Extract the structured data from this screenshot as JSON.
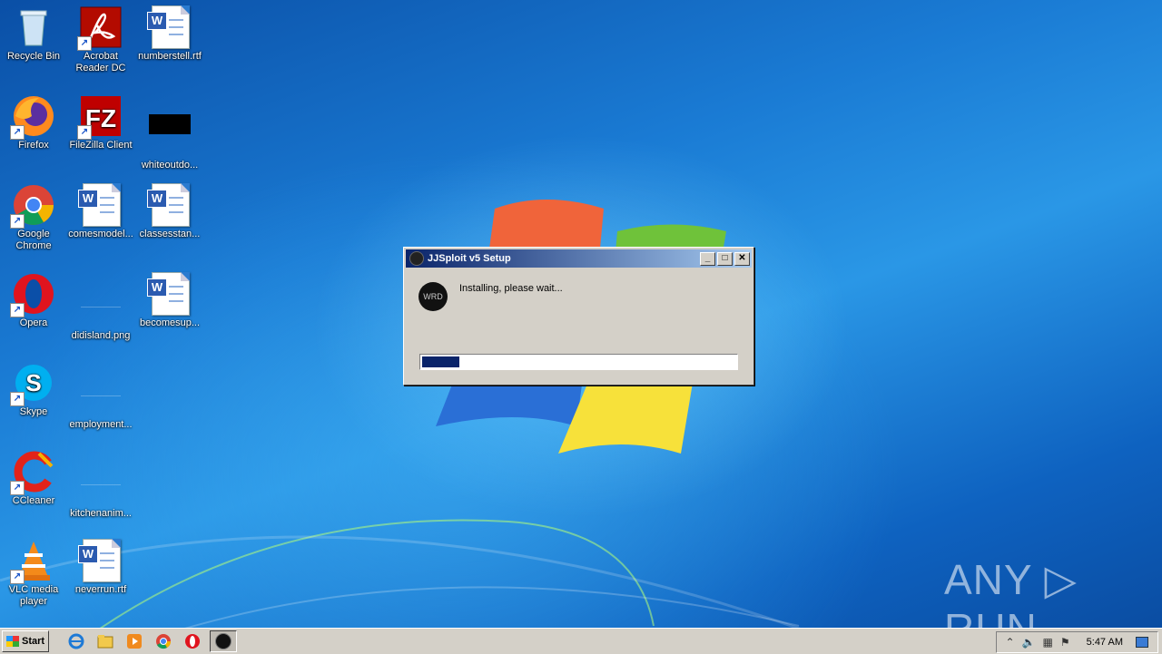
{
  "desktop": {
    "icons": [
      {
        "label": "Recycle Bin",
        "icon": "recycle-bin-icon"
      },
      {
        "label": "Acrobat Reader DC",
        "icon": "acrobat-icon"
      },
      {
        "label": "numberstell.rtf",
        "icon": "word-doc-icon"
      },
      {
        "label": "Firefox",
        "icon": "firefox-icon"
      },
      {
        "label": "FileZilla Client",
        "icon": "filezilla-icon"
      },
      {
        "label": "whiteoutdo...",
        "icon": "black-image-icon"
      },
      {
        "label": "Google Chrome",
        "icon": "chrome-icon"
      },
      {
        "label": "comesmodel...",
        "icon": "word-doc-icon"
      },
      {
        "label": "classesstan...",
        "icon": "word-doc-icon"
      },
      {
        "label": "Opera",
        "icon": "opera-icon"
      },
      {
        "label": "didisland.png",
        "icon": "image-file-icon"
      },
      {
        "label": "becomesup...",
        "icon": "word-doc-icon"
      },
      {
        "label": "Skype",
        "icon": "skype-icon"
      },
      {
        "label": "employment...",
        "icon": "file-icon"
      },
      {
        "label": "CCleaner",
        "icon": "ccleaner-icon"
      },
      {
        "label": "kitchenanim...",
        "icon": "file-icon"
      },
      {
        "label": "VLC media player",
        "icon": "vlc-icon"
      },
      {
        "label": "neverrun.rtf",
        "icon": "word-doc-icon"
      }
    ]
  },
  "dialog": {
    "title": "JJSploit v5 Setup",
    "logo_text": "WRD",
    "message": "Installing, please wait...",
    "progress": 0.13,
    "buttons": {
      "minimize": "_",
      "maximize": "□",
      "close": "✕"
    }
  },
  "taskbar": {
    "start_label": "Start",
    "clock": "5:47 AM"
  },
  "watermark": "ANY ▷ RUN"
}
